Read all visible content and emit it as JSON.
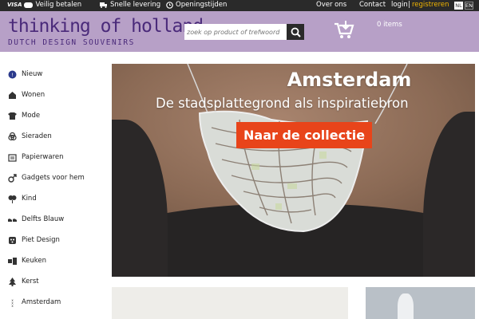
{
  "topbar": {
    "card_brand": "VISA",
    "secure_pay": "Veilig betalen",
    "fast_delivery": "Snelle levering",
    "opening_hours": "Openingstijden",
    "about": "Over ons",
    "contact": "Contact",
    "login": "login",
    "separator": "|",
    "register": "registreren",
    "lang_nl": "NL",
    "lang_en": "EN"
  },
  "header": {
    "logo_main": "thinking of holland",
    "logo_sub": "DUTCH DESIGN SOUVENIRS",
    "search_placeholder": "zoek op product of trefwoord",
    "cart_count": "0 items"
  },
  "sidebar": {
    "items": [
      {
        "label": "Nieuw",
        "icon": "new-icon"
      },
      {
        "label": "Wonen",
        "icon": "house-icon"
      },
      {
        "label": "Mode",
        "icon": "shirt-icon"
      },
      {
        "label": "Sieraden",
        "icon": "rings-icon"
      },
      {
        "label": "Papierwaren",
        "icon": "paper-icon"
      },
      {
        "label": "Gadgets voor hem",
        "icon": "male-icon"
      },
      {
        "label": "Kind",
        "icon": "balloons-icon"
      },
      {
        "label": "Delfts Blauw",
        "icon": "clogs-icon"
      },
      {
        "label": "Piet Design",
        "icon": "piet-icon"
      },
      {
        "label": "Keuken",
        "icon": "kitchen-icon"
      },
      {
        "label": "Kerst",
        "icon": "tree-icon"
      },
      {
        "label": "Amsterdam",
        "icon": "xxx-icon"
      }
    ]
  },
  "hero": {
    "title": "Amsterdam",
    "subtitle": "De stadsplattegrond als inspiratiebron",
    "cta": "Naar de collectie"
  },
  "colors": {
    "header_bg": "#b7a0c7",
    "logo": "#4a2a7a",
    "cta": "#e8441a",
    "topbar": "#2a2a2a",
    "register_link": "#f0b400"
  }
}
